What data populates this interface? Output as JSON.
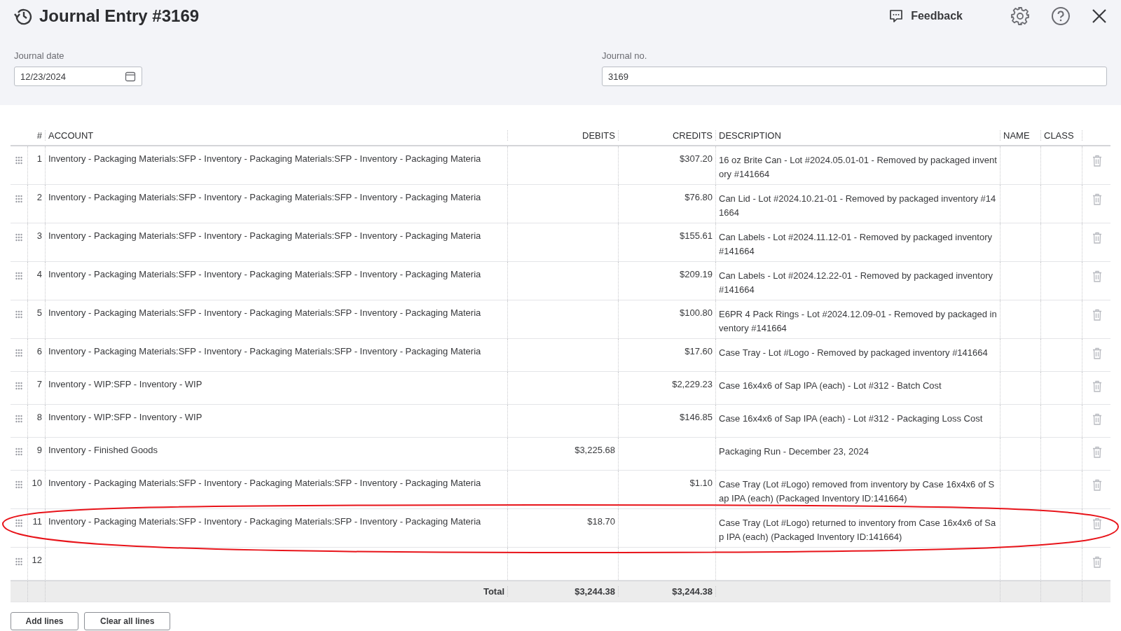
{
  "header": {
    "title": "Journal Entry #3169",
    "feedback": "Feedback"
  },
  "fields": [
    {
      "label": "Journal date",
      "value": "12/23/2024",
      "kind": "date"
    },
    {
      "label": "Journal no.",
      "value": "3169",
      "kind": "text"
    }
  ],
  "table": {
    "columns": [
      "#",
      "ACCOUNT",
      "DEBITS",
      "CREDITS",
      "DESCRIPTION",
      "NAME",
      "CLASS"
    ],
    "rows": [
      {
        "number": "1",
        "account": "Inventory - Packaging Materials:SFP - Inventory - Packaging Materials:SFP - Inventory - Packaging Materia",
        "credit": "$307.20",
        "description": "16 oz Brite Can - Lot #2024.05.01-01 - Removed by packaged inventory #141664"
      },
      {
        "number": "2",
        "account": "Inventory - Packaging Materials:SFP - Inventory - Packaging Materials:SFP - Inventory - Packaging Materia",
        "credit": "$76.80",
        "description": "Can Lid - Lot #2024.10.21-01 - Removed by packaged inventory #141664"
      },
      {
        "number": "3",
        "account": "Inventory - Packaging Materials:SFP - Inventory - Packaging Materials:SFP - Inventory - Packaging Materia",
        "credit": "$155.61",
        "description": "Can Labels - Lot #2024.11.12-01 - Removed by packaged inventory #141664"
      },
      {
        "number": "4",
        "account": "Inventory - Packaging Materials:SFP - Inventory - Packaging Materials:SFP - Inventory - Packaging Materia",
        "credit": "$209.19",
        "description": "Can Labels - Lot #2024.12.22-01 - Removed by packaged inventory #141664"
      },
      {
        "number": "5",
        "account": "Inventory - Packaging Materials:SFP - Inventory - Packaging Materials:SFP - Inventory - Packaging Materia",
        "credit": "$100.80",
        "description": "E6PR 4 Pack Rings - Lot #2024.12.09-01 - Removed by packaged inventory #141664"
      },
      {
        "number": "6",
        "account": "Inventory - Packaging Materials:SFP - Inventory - Packaging Materials:SFP - Inventory - Packaging Materia",
        "credit": "$17.60",
        "description": "Case Tray - Lot #Logo - Removed by packaged inventory #141664"
      },
      {
        "number": "7",
        "account": "Inventory - WIP:SFP - Inventory - WIP",
        "credit": "$2,229.23",
        "description": "Case 16x4x6 of Sap IPA (each) - Lot #312 - Batch Cost"
      },
      {
        "number": "8",
        "account": "Inventory - WIP:SFP - Inventory - WIP",
        "credit": "$146.85",
        "description": "Case 16x4x6 of Sap IPA (each) - Lot #312 - Packaging Loss Cost"
      },
      {
        "number": "9",
        "account": "Inventory - Finished Goods",
        "debit": "$3,225.68",
        "description": "Packaging Run - December 23, 2024"
      },
      {
        "number": "10",
        "account": "Inventory - Packaging Materials:SFP - Inventory - Packaging Materials:SFP - Inventory - Packaging Materia",
        "credit": "$1.10",
        "description": "Case Tray (Lot #Logo) removed from inventory by Case 16x4x6 of Sap IPA (each) (Packaged Inventory ID:141664)"
      },
      {
        "number": "11",
        "account": "Inventory - Packaging Materials:SFP - Inventory - Packaging Materials:SFP - Inventory - Packaging Materia",
        "debit": "$18.70",
        "description": "Case Tray (Lot #Logo) returned to inventory from Case 16x4x6 of Sap IPA (each) (Packaged Inventory ID:141664)"
      },
      {
        "number": "12"
      }
    ],
    "total": {
      "label": "Total",
      "debit": "$3,244.38",
      "credit": "$3,244.38"
    }
  },
  "buttons": [
    "Add lines",
    "Clear all lines"
  ]
}
